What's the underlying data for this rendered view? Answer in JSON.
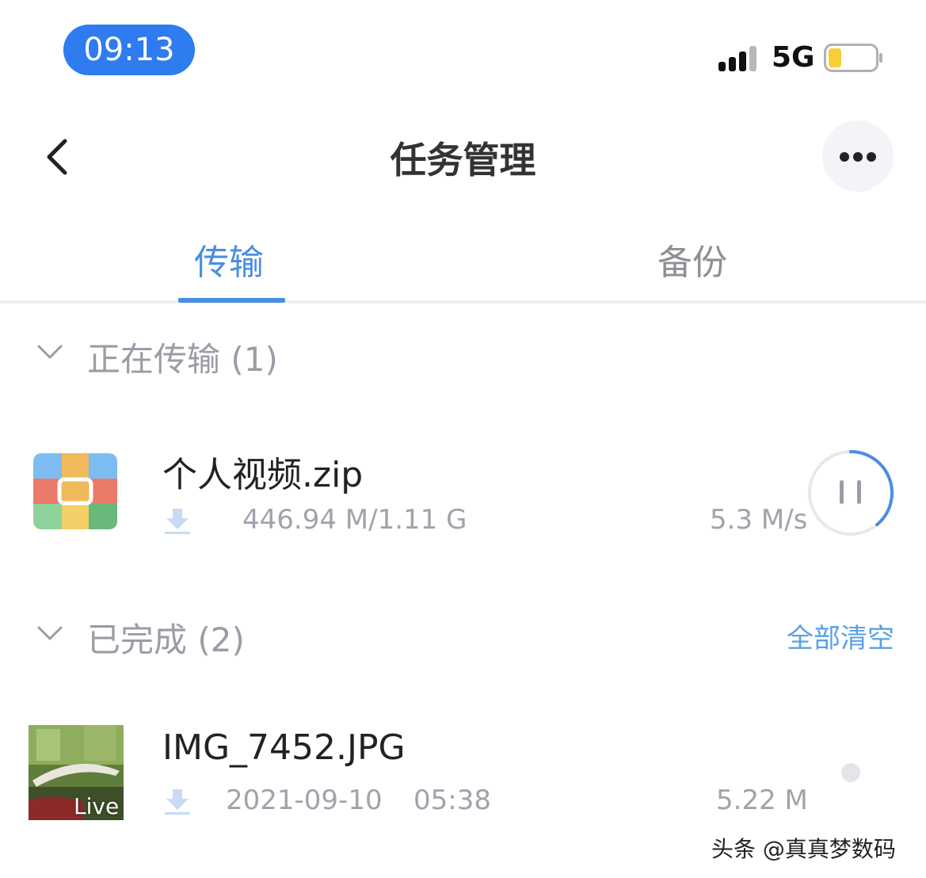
{
  "status_bar": {
    "time": "09:13",
    "network": "5G"
  },
  "header": {
    "title": "任务管理"
  },
  "tabs": [
    {
      "label": "传输",
      "active": true
    },
    {
      "label": "备份",
      "active": false
    }
  ],
  "transferring": {
    "title": "正在传输 (1)",
    "items": [
      {
        "name": "个人视频.zip",
        "progress_text": "446.94 M/1.11 G",
        "speed": "5.3 M/s",
        "progress": 0.39
      }
    ]
  },
  "completed": {
    "title": "已完成 (2)",
    "clear_label": "全部清空",
    "items": [
      {
        "name": "IMG_7452.JPG",
        "date": "2021-09-10",
        "time": "05:38",
        "size": "5.22 M",
        "badge": "Live"
      }
    ]
  },
  "watermark": "头条 @真真梦数码",
  "colors": {
    "accent": "#4a8fdf",
    "time_pill": "#2f7bf0",
    "battery": "#f4cf3a"
  }
}
